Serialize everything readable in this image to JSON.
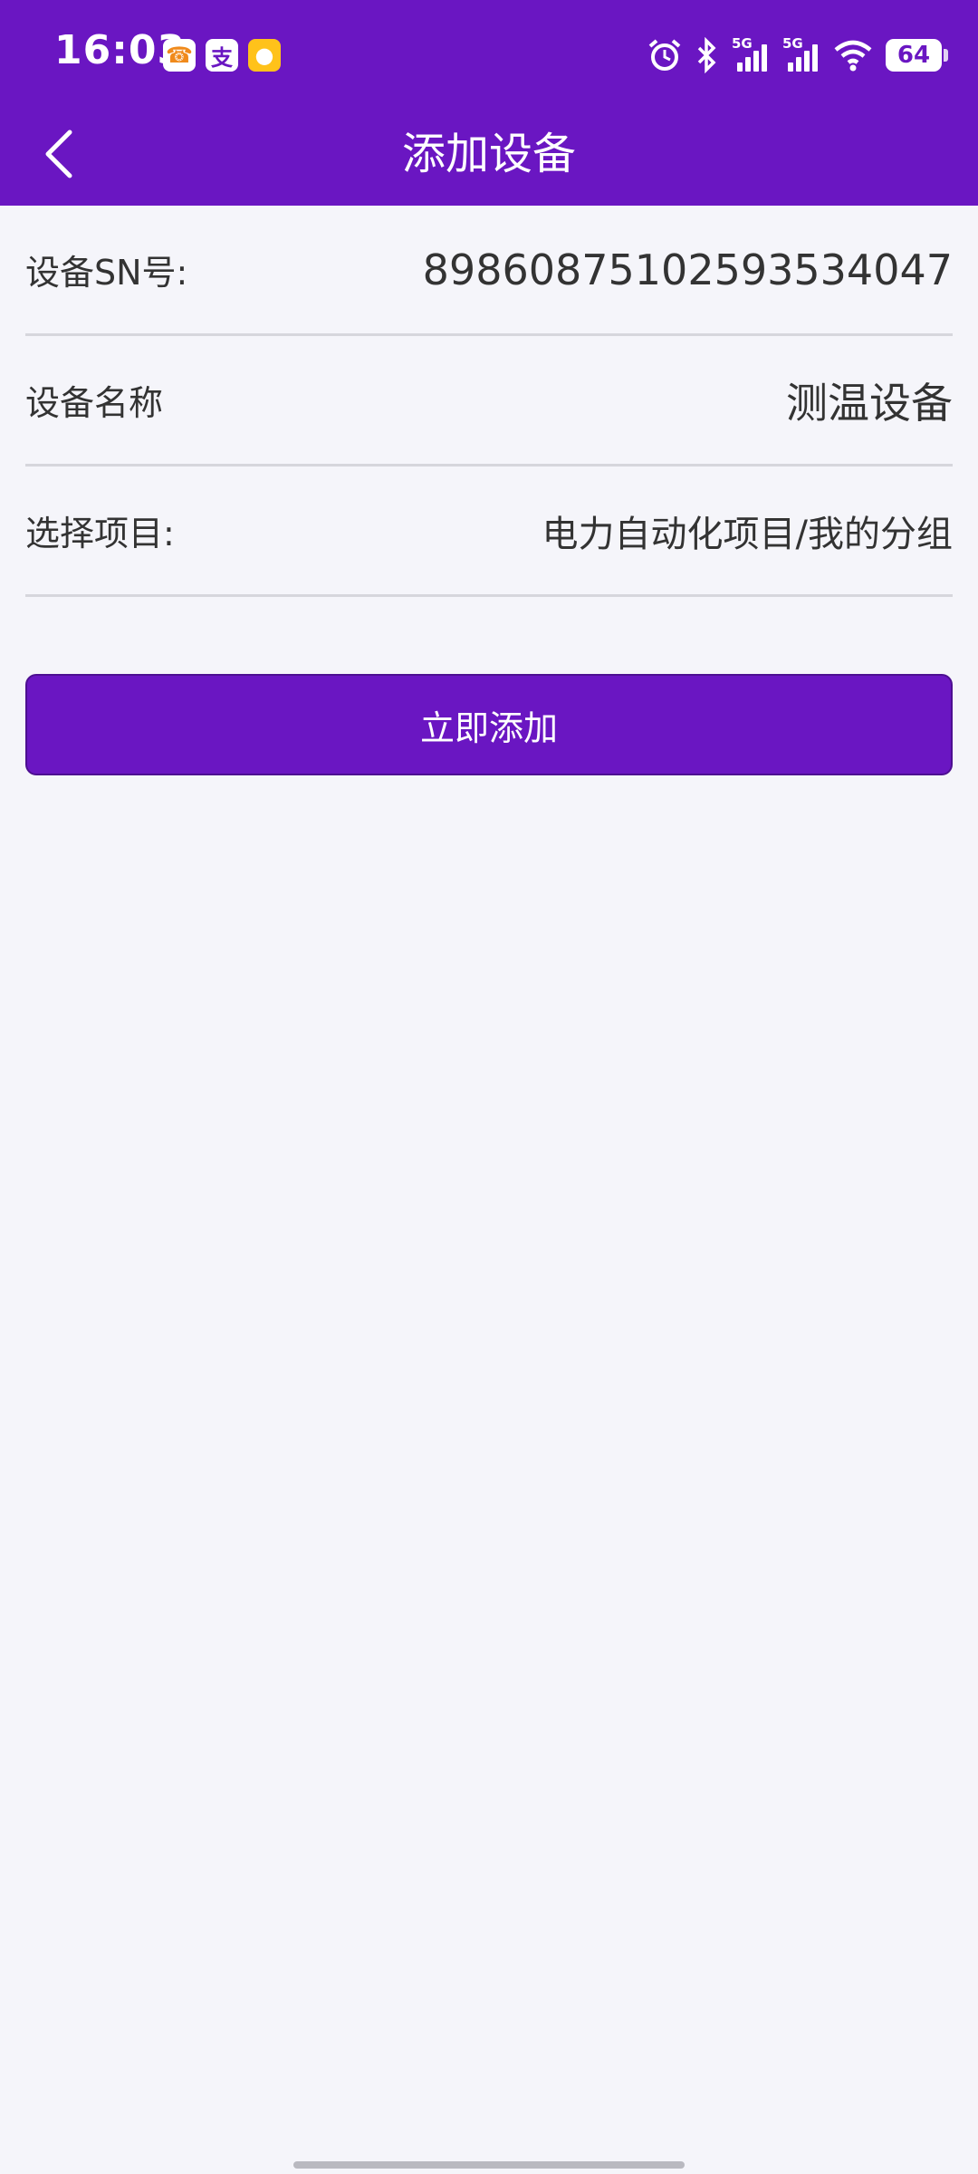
{
  "status_bar": {
    "time": "16:03",
    "battery": "64",
    "signal1_label": "5G",
    "signal2_label": "5G",
    "icons": [
      "app-icon-1",
      "alipay-icon",
      "app-icon-3",
      "alarm-icon",
      "bluetooth-icon",
      "signal-icon",
      "signal-icon",
      "wifi-icon",
      "battery-icon"
    ]
  },
  "nav": {
    "title": "添加设备",
    "back_icon": "back-icon"
  },
  "form": {
    "sn": {
      "label": "设备SN号:",
      "value": "89860875102593534047"
    },
    "name": {
      "label": "设备名称",
      "value": "测温设备"
    },
    "project": {
      "label": "选择项目:",
      "value": "电力自动化项目/我的分组"
    }
  },
  "submit_label": "立即添加",
  "colors": {
    "primary": "#6a16c2",
    "background": "#f5f5fa",
    "divider": "#d6d6dc",
    "text": "#333333"
  }
}
